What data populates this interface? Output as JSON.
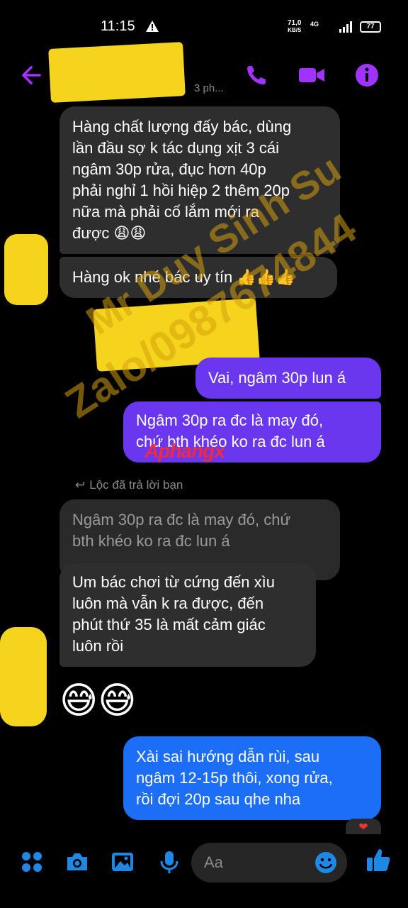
{
  "status": {
    "time": "11:15",
    "speed_value": "71,0",
    "speed_unit": "KB/S",
    "network": "4G",
    "battery": "77"
  },
  "header": {
    "seen_time": "3 ph..."
  },
  "messages": {
    "m1": [
      "Hàng chất lượng đấy bác, dùng",
      "lần đầu sợ k tác dụng xịt 3 cái",
      "ngâm 30p rửa, đục hơn 40p",
      "phải nghỉ 1 hồi hiệp 2 thêm 20p",
      "nữa mà phải cố lắm mới ra",
      "được 😩😩"
    ],
    "m2": [
      "Hàng ok nhé bác uy tín 👍👍👍"
    ],
    "m3": [
      "Vai, ngâm 30p lun á"
    ],
    "m4": [
      "Ngâm 30p ra đc là may đó,",
      "chứ bth khéo ko ra đc lun á"
    ],
    "reply_label": "Lộc đã trả lời bạn",
    "m5_quote": [
      "Ngâm 30p ra đc là may đó, chứ",
      "bth khéo ko ra đc lun á"
    ],
    "m6": [
      "Um bác chơi từ cứng đến xìu",
      "luôn mà vẫn k ra được, đến",
      "phút thứ 35 là mất cảm giác",
      "luôn rồi"
    ],
    "m7": "😅😅",
    "m8": [
      "Xài sai hướng dẫn rùi, sau",
      "ngâm  12-15p thôi, xong rửa,",
      "rồi đợi 20p sau qhe nha"
    ],
    "reaction": "❤"
  },
  "watermark": {
    "line1": "Mr Duy Sinh Su",
    "line2": "Zalo/0987674844",
    "logo": "Aphangx"
  },
  "composer": {
    "placeholder": "Aa"
  },
  "colors": {
    "accent": "#a033ff",
    "bubble_out": "#6a37ee",
    "bubble_out_last": "#1b6ef5",
    "bubble_in": "#2e2e2e",
    "composer_blue": "#1e88e5"
  }
}
